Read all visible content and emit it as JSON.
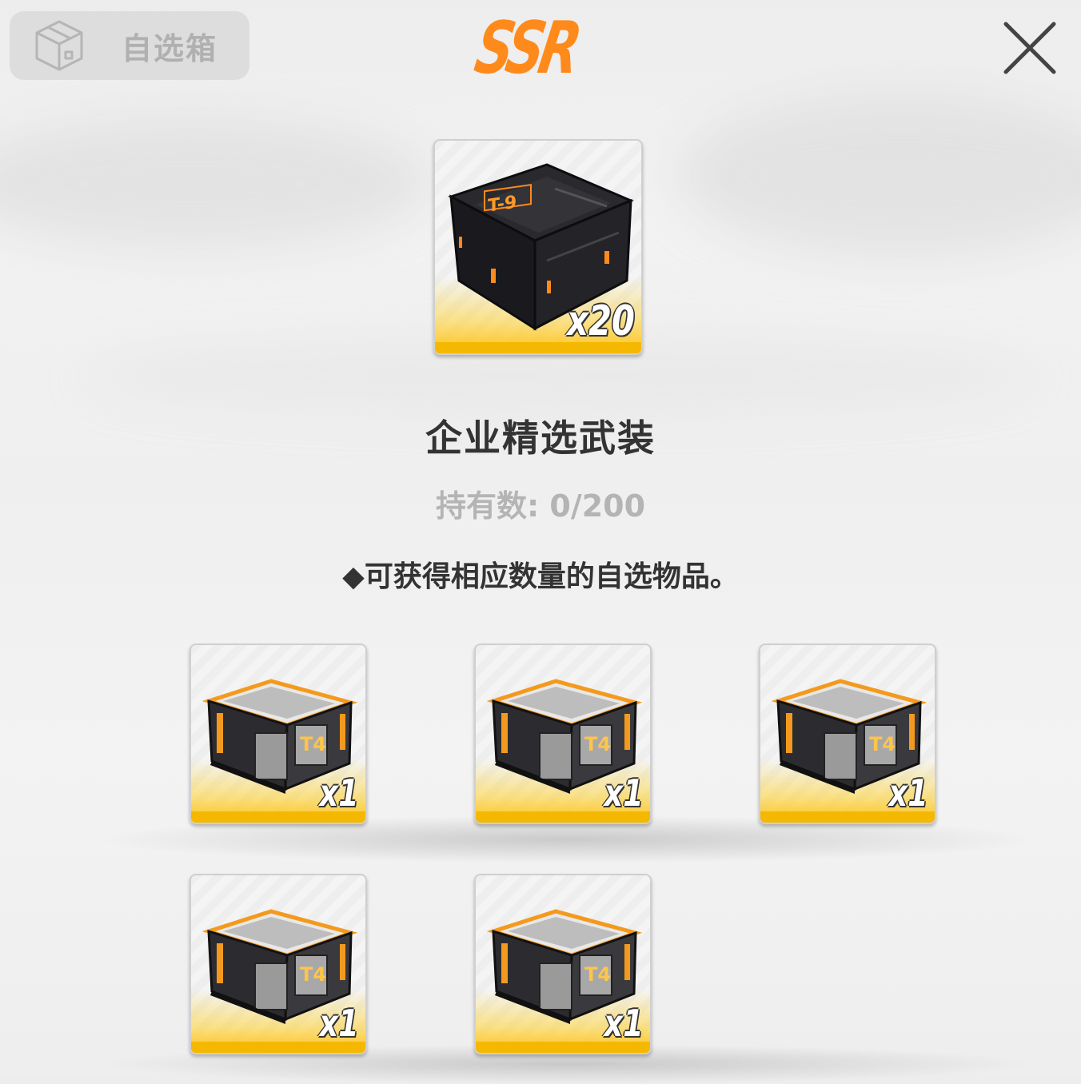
{
  "header": {
    "category_label": "自选箱",
    "rarity": "SSR",
    "colors": {
      "rarity": "#ff8a1c",
      "highlight": "#f5b800"
    }
  },
  "main_item": {
    "quantity": "x20",
    "icon": "black-supply-crate",
    "name": "企业精选武装",
    "owned": "持有数: 0/200"
  },
  "description": "◆可获得相应数量的自选物品。",
  "options": [
    {
      "quantity": "x1",
      "icon": "t4-equipment-crate"
    },
    {
      "quantity": "x1",
      "icon": "t4-equipment-crate"
    },
    {
      "quantity": "x1",
      "icon": "t4-equipment-crate"
    },
    {
      "quantity": "x1",
      "icon": "t4-equipment-crate"
    },
    {
      "quantity": "x1",
      "icon": "t4-equipment-crate"
    }
  ]
}
